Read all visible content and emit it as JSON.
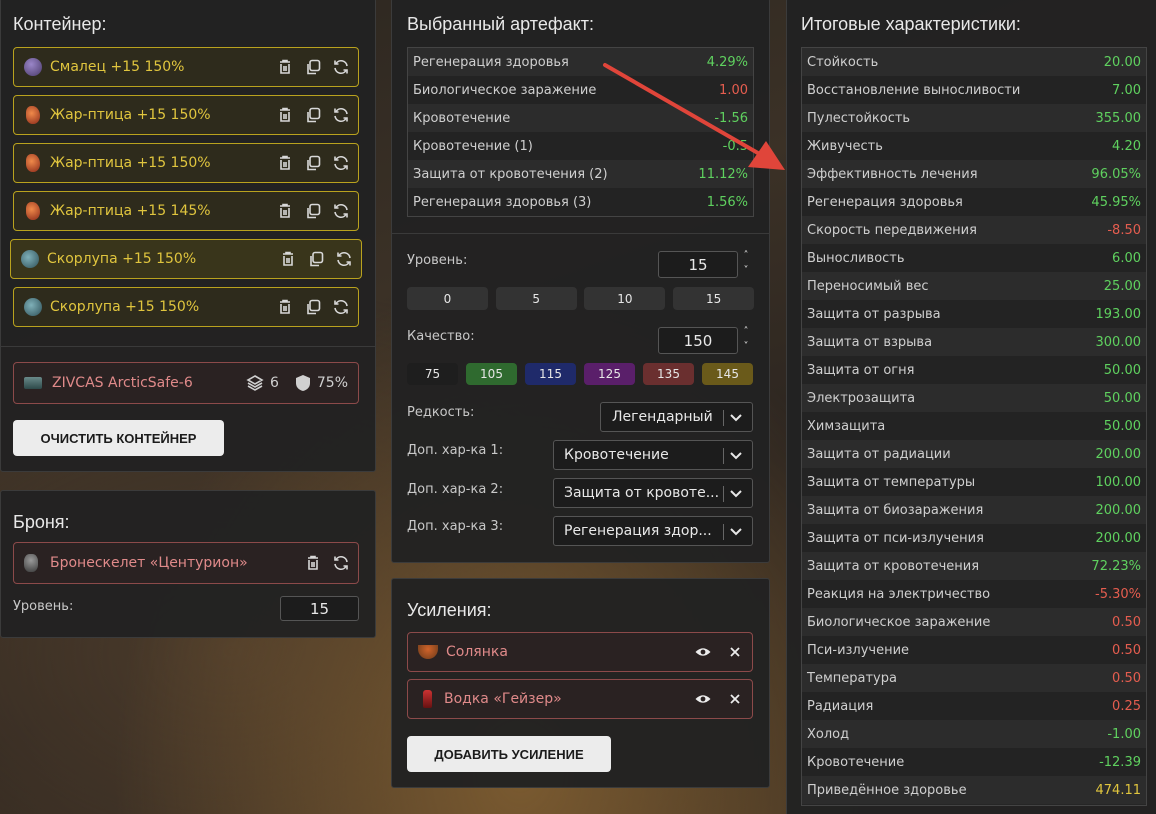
{
  "container": {
    "title": "Контейнер:",
    "items": [
      {
        "label": "Смалец +15 150%",
        "icon": "orb-icon"
      },
      {
        "label": "Жар-птица +15 150%",
        "icon": "firebird-icon"
      },
      {
        "label": "Жар-птица +15 150%",
        "icon": "firebird-icon"
      },
      {
        "label": "Жар-птица +15 145%",
        "icon": "firebird-icon"
      },
      {
        "label": "Скорлупа +15 150%",
        "icon": "shell-icon"
      },
      {
        "label": "Скорлупа +15 150%",
        "icon": "shell-icon"
      }
    ],
    "safe": {
      "label": "ZIVCAS ArcticSafe-6",
      "slots": "6",
      "protection": "75%"
    },
    "clear_button": "ОЧИСТИТЬ КОНТЕЙНЕР"
  },
  "armor": {
    "title": "Броня:",
    "item_label": "Бронескелет «Центурион»",
    "level_label": "Уровень:",
    "level_value": "15"
  },
  "artifact": {
    "title": "Выбранный артефакт:",
    "stats": [
      {
        "name": "Регенерация здоровья",
        "value": "4.29%",
        "tone": "pos"
      },
      {
        "name": "Биологическое заражение",
        "value": "1.00",
        "tone": "neg"
      },
      {
        "name": "Кровотечение",
        "value": "-1.56",
        "tone": "pos"
      },
      {
        "name": "Кровотечение (1)",
        "value": "-0.5",
        "tone": "pos"
      },
      {
        "name": "Защита от кровотечения (2)",
        "value": "11.12%",
        "tone": "pos"
      },
      {
        "name": "Регенерация здоровья (3)",
        "value": "1.56%",
        "tone": "pos"
      }
    ],
    "level_label": "Уровень:",
    "level_value": "15",
    "level_presets": [
      "0",
      "5",
      "10",
      "15"
    ],
    "quality_label": "Качество:",
    "quality_value": "150",
    "quality_presets": [
      {
        "label": "75",
        "color": "#1e1e1e"
      },
      {
        "label": "105",
        "color": "#2f6a2f"
      },
      {
        "label": "115",
        "color": "#1f2a6a"
      },
      {
        "label": "125",
        "color": "#5a1f6a"
      },
      {
        "label": "135",
        "color": "#6a2f2f"
      },
      {
        "label": "145",
        "color": "#6a5a1a"
      }
    ],
    "rarity_label": "Редкость:",
    "rarity_value": "Легендарный",
    "extra1_label": "Доп. хар-ка 1:",
    "extra1_value": "Кровотечение",
    "extra2_label": "Доп. хар-ка 2:",
    "extra2_value": "Защита от кровоте...",
    "extra3_label": "Доп. хар-ка 3:",
    "extra3_value": "Регенерация здор..."
  },
  "boosts": {
    "title": "Усиления:",
    "items": [
      {
        "label": "Солянка",
        "icon": "soup-icon"
      },
      {
        "label": "Водка «Гейзер»",
        "icon": "bottle-icon"
      }
    ],
    "add_button": "ДОБАВИТЬ УСИЛЕНИЕ"
  },
  "totals": {
    "title": "Итоговые характеристики:",
    "stats": [
      {
        "name": "Стойкость",
        "value": "20.00",
        "tone": "pos"
      },
      {
        "name": "Восстановление выносливости",
        "value": "7.00",
        "tone": "pos"
      },
      {
        "name": "Пулестойкость",
        "value": "355.00",
        "tone": "pos"
      },
      {
        "name": "Живучесть",
        "value": "4.20",
        "tone": "pos"
      },
      {
        "name": "Эффективность лечения",
        "value": "96.05%",
        "tone": "pos"
      },
      {
        "name": "Регенерация здоровья",
        "value": "45.95%",
        "tone": "pos"
      },
      {
        "name": "Скорость передвижения",
        "value": "-8.50",
        "tone": "neg"
      },
      {
        "name": "Выносливость",
        "value": "6.00",
        "tone": "pos"
      },
      {
        "name": "Переносимый вес",
        "value": "25.00",
        "tone": "pos"
      },
      {
        "name": "Защита от разрыва",
        "value": "193.00",
        "tone": "pos"
      },
      {
        "name": "Защита от взрыва",
        "value": "300.00",
        "tone": "pos"
      },
      {
        "name": "Защита от огня",
        "value": "50.00",
        "tone": "pos"
      },
      {
        "name": "Электрозащита",
        "value": "50.00",
        "tone": "pos"
      },
      {
        "name": "Химзащита",
        "value": "50.00",
        "tone": "pos"
      },
      {
        "name": "Защита от радиации",
        "value": "200.00",
        "tone": "pos"
      },
      {
        "name": "Защита от температуры",
        "value": "100.00",
        "tone": "pos"
      },
      {
        "name": "Защита от биозаражения",
        "value": "200.00",
        "tone": "pos"
      },
      {
        "name": "Защита от пси-излучения",
        "value": "200.00",
        "tone": "pos"
      },
      {
        "name": "Защита от кровотечения",
        "value": "72.23%",
        "tone": "pos"
      },
      {
        "name": "Реакция на электричество",
        "value": "-5.30%",
        "tone": "neg"
      },
      {
        "name": "Биологическое заражение",
        "value": "0.50",
        "tone": "neg"
      },
      {
        "name": "Пси-излучение",
        "value": "0.50",
        "tone": "neg"
      },
      {
        "name": "Температура",
        "value": "0.50",
        "tone": "neg"
      },
      {
        "name": "Радиация",
        "value": "0.25",
        "tone": "neg"
      },
      {
        "name": "Холод",
        "value": "-1.00",
        "tone": "pos"
      },
      {
        "name": "Кровотечение",
        "value": "-12.39",
        "tone": "pos"
      },
      {
        "name": "Приведённое здоровье",
        "value": "474.11",
        "tone": "gold"
      }
    ]
  },
  "colors": {
    "accent_gold": "#e0c53e",
    "positive": "#5fd15f",
    "negative": "#e55d4f",
    "arrow": "#e0453a"
  }
}
